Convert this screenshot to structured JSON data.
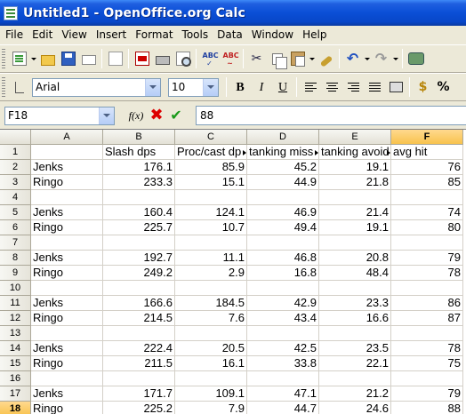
{
  "window": {
    "title": "Untitled1 - OpenOffice.org Calc"
  },
  "menu": [
    "File",
    "Edit",
    "View",
    "Insert",
    "Format",
    "Tools",
    "Data",
    "Window",
    "Help"
  ],
  "formatting": {
    "font": "Arial",
    "size": "10"
  },
  "formula_bar": {
    "name_box": "F18",
    "fx_label": "f(x)",
    "content": "88"
  },
  "columns": [
    "A",
    "B",
    "C",
    "D",
    "E",
    "F"
  ],
  "selected": {
    "column": "F",
    "row": "18"
  },
  "rows": [
    {
      "num": "1",
      "cells": [
        "",
        "Slash dps",
        "Proc/cast dp",
        "tanking miss",
        "tanking avoid",
        "avg hit"
      ]
    },
    {
      "num": "2",
      "cells": [
        "Jenks",
        "176.1",
        "85.9",
        "45.2",
        "19.1",
        "76"
      ]
    },
    {
      "num": "3",
      "cells": [
        "Ringo",
        "233.3",
        "15.1",
        "44.9",
        "21.8",
        "85"
      ]
    },
    {
      "num": "4",
      "cells": [
        "",
        "",
        "",
        "",
        "",
        ""
      ]
    },
    {
      "num": "5",
      "cells": [
        "Jenks",
        "160.4",
        "124.1",
        "46.9",
        "21.4",
        "74"
      ]
    },
    {
      "num": "6",
      "cells": [
        "Ringo",
        "225.7",
        "10.7",
        "49.4",
        "19.1",
        "80"
      ]
    },
    {
      "num": "7",
      "cells": [
        "",
        "",
        "",
        "",
        "",
        ""
      ]
    },
    {
      "num": "8",
      "cells": [
        "Jenks",
        "192.7",
        "11.1",
        "46.8",
        "20.8",
        "79"
      ]
    },
    {
      "num": "9",
      "cells": [
        "Ringo",
        "249.2",
        "2.9",
        "16.8",
        "48.4",
        "78"
      ]
    },
    {
      "num": "10",
      "cells": [
        "",
        "",
        "",
        "",
        "",
        ""
      ]
    },
    {
      "num": "11",
      "cells": [
        "Jenks",
        "166.6",
        "184.5",
        "42.9",
        "23.3",
        "86"
      ]
    },
    {
      "num": "12",
      "cells": [
        "Ringo",
        "214.5",
        "7.6",
        "43.4",
        "16.6",
        "87"
      ]
    },
    {
      "num": "13",
      "cells": [
        "",
        "",
        "",
        "",
        "",
        ""
      ]
    },
    {
      "num": "14",
      "cells": [
        "Jenks",
        "222.4",
        "20.5",
        "42.5",
        "23.5",
        "78"
      ]
    },
    {
      "num": "15",
      "cells": [
        "Ringo",
        "211.5",
        "16.1",
        "33.8",
        "22.1",
        "75"
      ]
    },
    {
      "num": "16",
      "cells": [
        "",
        "",
        "",
        "",
        "",
        ""
      ]
    },
    {
      "num": "17",
      "cells": [
        "Jenks",
        "171.7",
        "109.1",
        "47.1",
        "21.2",
        "79"
      ]
    },
    {
      "num": "18",
      "cells": [
        "Ringo",
        "225.2",
        "7.9",
        "44.7",
        "24.6",
        "88"
      ]
    }
  ]
}
